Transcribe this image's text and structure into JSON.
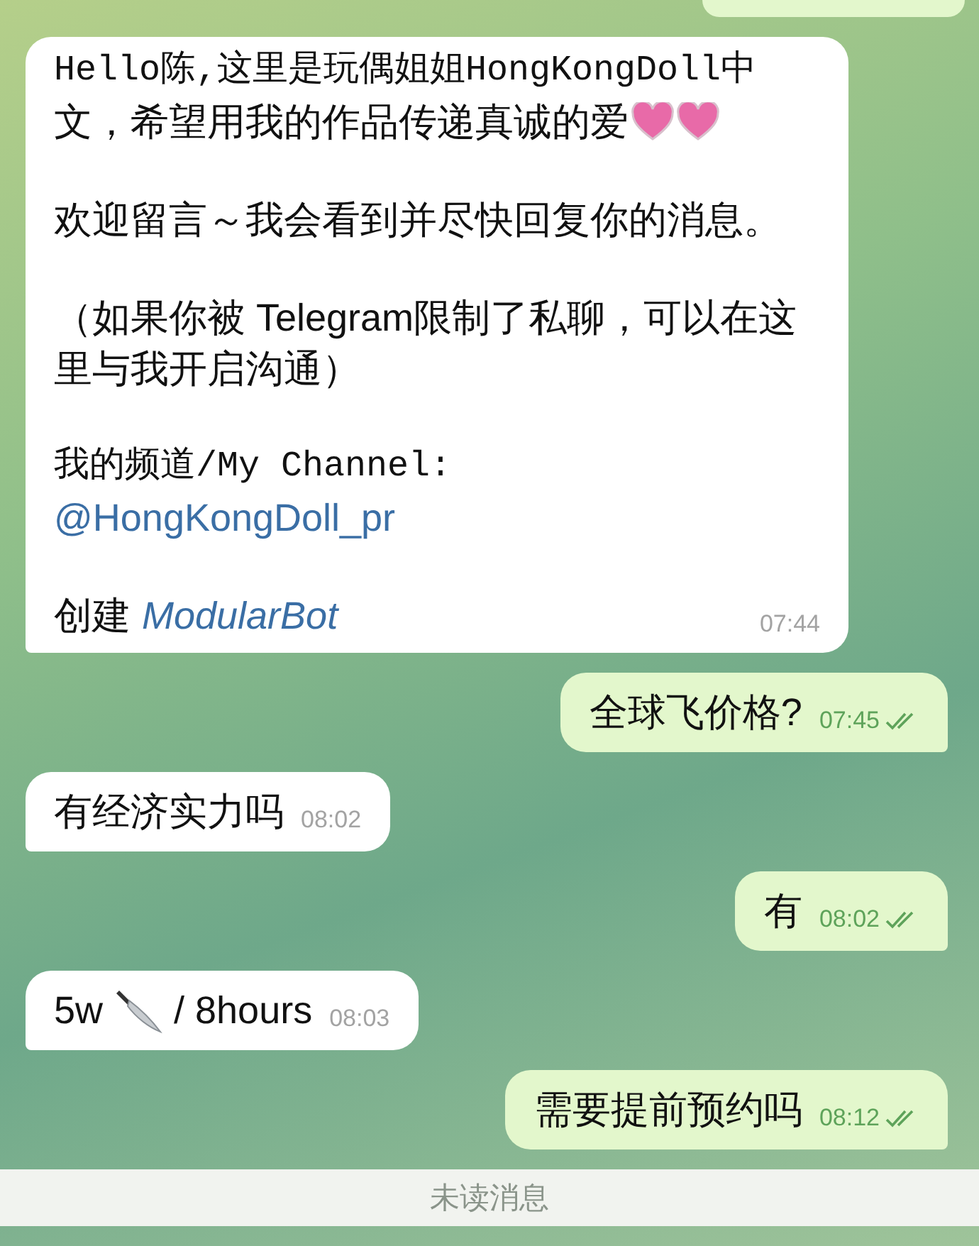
{
  "messages": [
    {
      "kind": "outgoing-cut"
    },
    {
      "kind": "incoming",
      "paragraphs": [
        {
          "parts": [
            {
              "kind": "mono",
              "text": "Hello陈,这里是玩偶姐姐HongKongDoll中"
            },
            {
              "kind": "text",
              "text": "文，希望用我的作品传递真诚的爱"
            },
            {
              "kind": "heart"
            },
            {
              "kind": "heart"
            }
          ]
        },
        {
          "parts": [
            {
              "kind": "text",
              "text": "欢迎留言～我会看到并尽快回复你的消息。"
            }
          ]
        },
        {
          "parts": [
            {
              "kind": "text",
              "text": "（如果你被 Telegram限制了私聊，可以在这里与我开启沟通）"
            }
          ]
        },
        {
          "parts": [
            {
              "kind": "mono",
              "text": "我的频道/My Channel:"
            },
            {
              "kind": "link",
              "text": "@HongKongDoll_pr"
            }
          ]
        },
        {
          "parts": [
            {
              "kind": "text",
              "text": "创建"
            },
            {
              "kind": "bot",
              "text": "ModularBot"
            }
          ]
        }
      ],
      "time": "07:44"
    },
    {
      "kind": "outgoing",
      "paragraphs": [
        {
          "parts": [
            {
              "kind": "text",
              "text": "全球飞价格?"
            }
          ]
        }
      ],
      "time": "07:45",
      "read": true
    },
    {
      "kind": "incoming",
      "paragraphs": [
        {
          "parts": [
            {
              "kind": "text",
              "text": "有经济实力吗"
            }
          ]
        }
      ],
      "time": "08:02"
    },
    {
      "kind": "outgoing",
      "paragraphs": [
        {
          "parts": [
            {
              "kind": "text",
              "text": "有"
            }
          ]
        }
      ],
      "time": "08:02",
      "read": true
    },
    {
      "kind": "incoming",
      "paragraphs": [
        {
          "parts": [
            {
              "kind": "text",
              "text": "5w"
            },
            {
              "kind": "knife"
            },
            {
              "kind": "text",
              "text": "/ 8hours"
            }
          ]
        }
      ],
      "time": "08:03"
    },
    {
      "kind": "outgoing",
      "paragraphs": [
        {
          "parts": [
            {
              "kind": "text",
              "text": "需要提前预约吗"
            }
          ]
        }
      ],
      "time": "08:12",
      "read": true
    }
  ],
  "unread_bar": {
    "label": "未读消息"
  }
}
